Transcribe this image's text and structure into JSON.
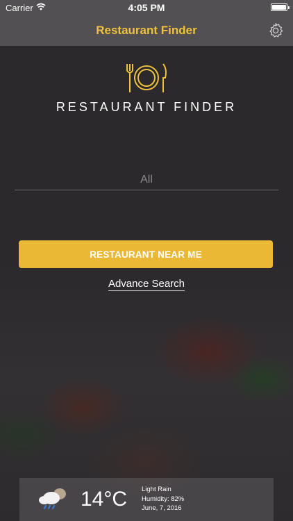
{
  "status_bar": {
    "carrier": "Carrier",
    "time": "4:05 PM",
    "battery_level": 1.0
  },
  "nav": {
    "title": "Restaurant Finder",
    "settings_icon": "gear-icon"
  },
  "logo": {
    "text": "RESTAURANT FINDER",
    "icon": "fork-plate-knife-icon"
  },
  "search": {
    "placeholder": "All",
    "value": ""
  },
  "primary_button": {
    "label": "RESTAURANT NEAR ME"
  },
  "advance_search": {
    "label": "Advance Search"
  },
  "weather": {
    "icon": "cloud-rain-icon",
    "temperature": "14°C",
    "condition": "Light Rain",
    "humidity": "Humidity: 82%",
    "date": "June, 7, 2016"
  },
  "colors": {
    "accent": "#f0c13c",
    "button": "#ebb836",
    "background": "#2b292b",
    "bar": "#525052"
  }
}
